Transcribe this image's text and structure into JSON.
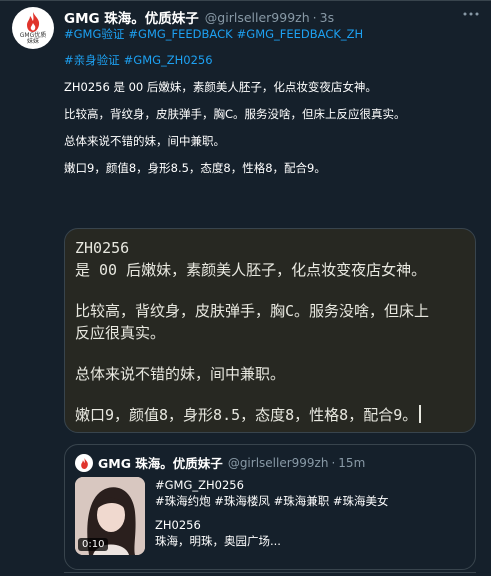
{
  "tweet": {
    "display_name": "GMG 珠海。优质妹子",
    "handle": "@girlseller999zh",
    "separator": "·",
    "time": "3s",
    "avatar_text": "GMG优质\n妹妹",
    "lines": {
      "hashtags_1": [
        "#GMG验证",
        "#GMG_FEEDBACK",
        "#GMG_FEEDBACK_ZH"
      ],
      "hashtags_2": [
        "#亲身验证",
        "#GMG_ZH0256"
      ],
      "intro": "ZH0256 是 00 后嫩妹，素颜美人胚子，化点妆变夜店女神。",
      "detail": "比较高，背纹身，皮肤弹手，胸C。服务没啥，但床上反应很真实。",
      "summary": "总体来说不错的妹，间中兼职。",
      "ratings": "嫩口9，颜值8，身形8.5，态度8，性格8，配合9。"
    }
  },
  "media": {
    "lines": [
      "ZH0256",
      "是 00 后嫩妹，素颜美人胚子，化点妆变夜店女神。",
      "",
      "比较高，背纹身，皮肤弹手，胸C。服务没啥，但床上",
      "反应很真实。",
      "",
      "总体来说不错的妹，间中兼职。",
      "",
      "嫩口9，颜值8，身形8.5，态度8，性格8，配合9。"
    ]
  },
  "quote": {
    "display_name": "GMG 珠海。优质妹子",
    "handle": "@girlseller999zh",
    "separator": "·",
    "time": "15m",
    "video_duration": "0:10",
    "hashtag_line_1": "#GMG_ZH0256",
    "hashtag_line_2": [
      "#珠海约炮",
      "#珠海楼凤",
      "#珠海兼职",
      "#珠海美女"
    ],
    "code": "ZH0256",
    "location": "珠海，明珠，奥园广场..."
  },
  "colors": {
    "background": "#15202b",
    "link": "#1da1f2",
    "muted": "#8899a6",
    "border": "#38444d",
    "media_bg": "#272822",
    "brand_red": "#e0342c"
  },
  "icons": {
    "more": "more-icon",
    "avatar_logo": "flame-logo-icon"
  }
}
